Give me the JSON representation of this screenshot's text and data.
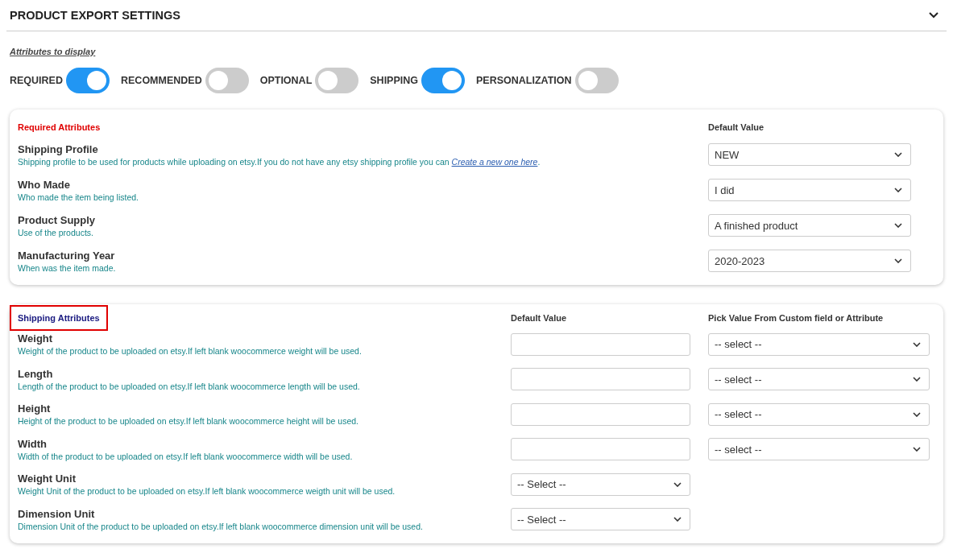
{
  "section": {
    "title": "PRODUCT EXPORT SETTINGS",
    "expanded": true
  },
  "attributes_to_display": {
    "label": "Attributes to display",
    "toggles": [
      {
        "label": "REQUIRED",
        "on": true
      },
      {
        "label": "RECOMMENDED",
        "on": false
      },
      {
        "label": "OPTIONAL",
        "on": false
      },
      {
        "label": "SHIPPING",
        "on": true
      },
      {
        "label": "PERSONALIZATION",
        "on": false
      }
    ]
  },
  "cards": [
    {
      "kind": "required",
      "title": "Required Attributes",
      "highlighted": false,
      "columns": [
        "Default Value"
      ],
      "rows": [
        {
          "name": "Shipping Profile",
          "description": "Shipping profile to be used for products while uploading on etsy.If you do not have any etsy shipping profile you can ",
          "link": "Create a new one here",
          "description_end": ".",
          "fields": [
            {
              "kind": "select",
              "value": "NEW"
            }
          ]
        },
        {
          "name": "Who Made",
          "description": "Who made the item being listed.",
          "fields": [
            {
              "kind": "select",
              "value": "I did"
            }
          ]
        },
        {
          "name": "Product Supply",
          "description": "Use of the products.",
          "fields": [
            {
              "kind": "select",
              "value": "A finished product"
            }
          ]
        },
        {
          "name": "Manufacturing Year",
          "description": "When was the item made.",
          "fields": [
            {
              "kind": "select",
              "value": "2020-2023"
            }
          ]
        }
      ]
    },
    {
      "kind": "shipping",
      "title": "Shipping Attributes",
      "highlighted": true,
      "columns": [
        "Default Value",
        "Pick Value From Custom field or Attribute"
      ],
      "rows": [
        {
          "name": "Weight",
          "description": "Weight of the product to be uploaded on etsy.If left blank woocommerce weight will be used.",
          "fields": [
            {
              "kind": "input"
            },
            {
              "kind": "select",
              "value": "-- select --"
            }
          ]
        },
        {
          "name": "Length",
          "description": "Length of the product to be uploaded on etsy.If left blank woocommerce length will be used.",
          "fields": [
            {
              "kind": "input"
            },
            {
              "kind": "select",
              "value": "-- select --"
            }
          ]
        },
        {
          "name": "Height",
          "description": "Height of the product to be uploaded on etsy.If left blank woocommerce height will be used.",
          "fields": [
            {
              "kind": "input"
            },
            {
              "kind": "select",
              "value": "-- select --"
            }
          ]
        },
        {
          "name": "Width",
          "description": "Width of the product to be uploaded on etsy.If left blank woocommerce width will be used.",
          "fields": [
            {
              "kind": "input"
            },
            {
              "kind": "select",
              "value": "-- select --"
            }
          ]
        },
        {
          "name": "Weight Unit",
          "description": "Weight Unit of the product to be uploaded on etsy.If left blank woocommerce weigth unit will be used.",
          "fields": [
            {
              "kind": "select",
              "value": "-- Select --"
            }
          ]
        },
        {
          "name": "Dimension Unit",
          "description": "Dimension Unit of the product to be uploaded on etsy.If left blank woocommerce dimension unit will be used.",
          "fields": [
            {
              "kind": "select",
              "value": "-- Select --"
            }
          ]
        }
      ]
    }
  ]
}
